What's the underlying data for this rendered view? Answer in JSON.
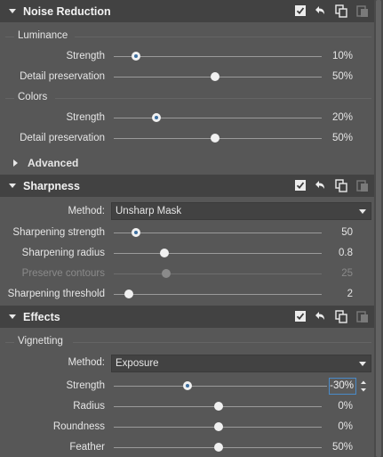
{
  "noise_reduction": {
    "title": "Noise Reduction",
    "luminance": {
      "title": "Luminance",
      "strength": {
        "label": "Strength",
        "value": "10%",
        "level": 0.1
      },
      "detail": {
        "label": "Detail preservation",
        "value": "50%",
        "level": 0.5
      }
    },
    "colors": {
      "title": "Colors",
      "strength": {
        "label": "Strength",
        "value": "20%",
        "level": 0.2
      },
      "detail": {
        "label": "Detail preservation",
        "value": "50%",
        "level": 0.5
      }
    },
    "advanced": {
      "title": "Advanced"
    }
  },
  "sharpness": {
    "title": "Sharpness",
    "method": {
      "label": "Method:",
      "value": "Unsharp Mask"
    },
    "strength": {
      "label": "Sharpening strength",
      "value": "50",
      "level": 0.1
    },
    "radius": {
      "label": "Sharpening radius",
      "value": "0.8",
      "level": 0.24
    },
    "contours": {
      "label": "Preserve contours",
      "value": "25",
      "level": 0.25
    },
    "threshold": {
      "label": "Sharpening threshold",
      "value": "2",
      "level": 0.07
    }
  },
  "effects": {
    "title": "Effects",
    "vignetting": {
      "title": "Vignetting",
      "method": {
        "label": "Method:",
        "value": "Exposure"
      },
      "strength": {
        "label": "Strength",
        "value": "-30%",
        "level": 0.35
      },
      "radius": {
        "label": "Radius",
        "value": "0%",
        "level": 0.5
      },
      "roundness": {
        "label": "Roundness",
        "value": "0%",
        "level": 0.5
      },
      "feather": {
        "label": "Feather",
        "value": "50%",
        "level": 0.5
      }
    }
  },
  "icons": {
    "enable": "checkbox-icon",
    "reset": "undo-icon",
    "copy": "copy-icon",
    "paste": "paste-icon"
  },
  "colors": {
    "accent": "#4a8ac8",
    "header_bg": "#424242",
    "panel_bg": "#575757"
  }
}
